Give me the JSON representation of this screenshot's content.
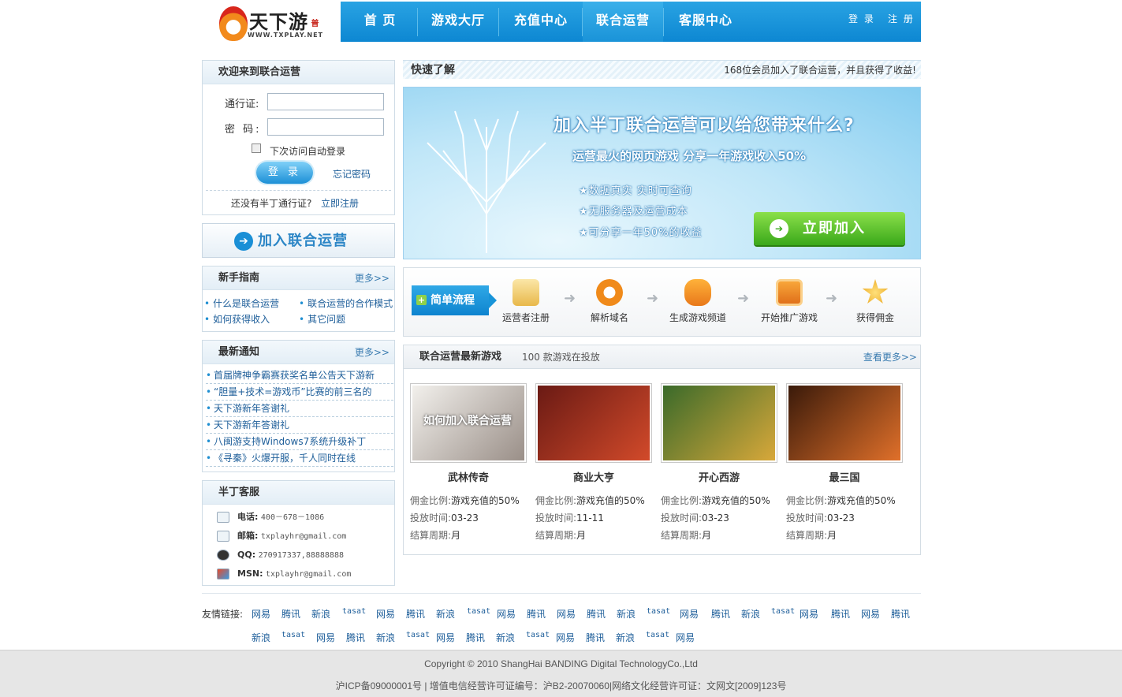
{
  "logo": {
    "text": "天下游",
    "sub": "WWW.TXPLAY.NET",
    "tag": "普"
  },
  "nav": {
    "items": [
      "首 页",
      "游戏大厅",
      "充值中心",
      "联合运营",
      "客服中心"
    ],
    "login": "登 录",
    "register": "注 册"
  },
  "login": {
    "title": "欢迎来到联合运营",
    "user_label": "通行证:",
    "pass_label": "密 码:",
    "remember": "下次访问自动登录",
    "button": "登 录",
    "forgot": "忘记密码",
    "no_account": "还没有半丁通行证?",
    "register_now": "立即注册"
  },
  "join_button": "加入联合运营",
  "guide": {
    "title": "新手指南",
    "more": "更多>>",
    "items": [
      "什么是联合运营",
      "联合运营的合作模式",
      "如何获得收入",
      "其它问题"
    ]
  },
  "notice": {
    "title": "最新通知",
    "more": "更多>>",
    "items": [
      "首届牌神争霸赛获奖名单公告天下游新",
      "“胆量+技术=游戏币”比赛的前三名的",
      "天下游新年答谢礼",
      "天下游新年答谢礼",
      "八闽游支持Windows7系统升级补丁",
      "《寻秦》火爆开服，千人同时在线"
    ]
  },
  "service": {
    "title": "半丁客服",
    "rows": [
      {
        "icon": "phone-icon",
        "label": "电话:",
        "value": "400－678－1086"
      },
      {
        "icon": "mail-icon",
        "label": "邮箱:",
        "value": "txplayhr@gmail.com"
      },
      {
        "icon": "qq-icon",
        "label": "QQ:",
        "value": "270917337,88888888"
      },
      {
        "icon": "msn-icon",
        "label": "MSN:",
        "value": "txplayhr@gmail.com"
      }
    ]
  },
  "quick": {
    "title": "快速了解",
    "right": "168位会员加入了联合运营，并且获得了收益!"
  },
  "banner": {
    "h1": "加入半丁联合运营可以给您带来什么?",
    "h2": "运营最火的网页游戏 分享一年游戏收入50%",
    "points": [
      "★数据真实   实时可查询",
      "★无服务器及运营成本",
      "★可分享一年50%的收益"
    ],
    "join": "立即加入"
  },
  "flow": {
    "tag": "简单流程",
    "steps": [
      "运营者注册",
      "解析域名",
      "生成游戏频道",
      "开始推广游戏",
      "获得佣金"
    ]
  },
  "games": {
    "title": "联合运营最新游戏",
    "count": "100 款游戏在投放",
    "more": "查看更多>>",
    "overlay": "如何加入联合运营",
    "commission_label": "佣金比例:",
    "time_label": "投放时间:",
    "period_label": "结算周期:",
    "list": [
      {
        "name": "武林传奇",
        "commission": "游戏充值的50%",
        "time": "03-23",
        "period": "月",
        "colors": [
          "#f2f0ec",
          "#9a8f88"
        ]
      },
      {
        "name": "商业大亨",
        "commission": "游戏充值的50%",
        "time": "11-11",
        "period": "月",
        "colors": [
          "#6a1a14",
          "#d24a2a"
        ]
      },
      {
        "name": "开心西游",
        "commission": "游戏充值的50%",
        "time": "03-23",
        "period": "月",
        "colors": [
          "#3a6a2a",
          "#d8a83a"
        ]
      },
      {
        "name": "最三国",
        "commission": "游戏充值的50%",
        "time": "03-23",
        "period": "月",
        "colors": [
          "#3a1a0a",
          "#e0702a"
        ]
      }
    ]
  },
  "links": {
    "label": "友情链接:",
    "row1": [
      "网易",
      "腾讯",
      "新浪",
      "tasat",
      "网易",
      "腾讯",
      "新浪",
      "tasat",
      "网易",
      "腾讯",
      "网易",
      "腾讯",
      "新浪",
      "tasat",
      "网易",
      "腾讯",
      "新浪",
      "tasat",
      "网易",
      "腾讯",
      "网易",
      "腾讯"
    ],
    "row2": [
      "新浪",
      "tasat",
      "网易",
      "腾讯",
      "新浪",
      "tasat",
      "网易",
      "腾讯",
      "新浪",
      "tasat",
      "网易",
      "腾讯",
      "新浪",
      "tasat",
      "网易"
    ]
  },
  "footer": {
    "copyright": "Copyright © 2010 ShangHai BANDING Digital TechnologyCo.,Ltd",
    "icp": "沪ICP备09000001号 | 增值电信经营许可证编号：沪B2-20070060|网络文化经营许可证：文网文[2009]123号"
  }
}
